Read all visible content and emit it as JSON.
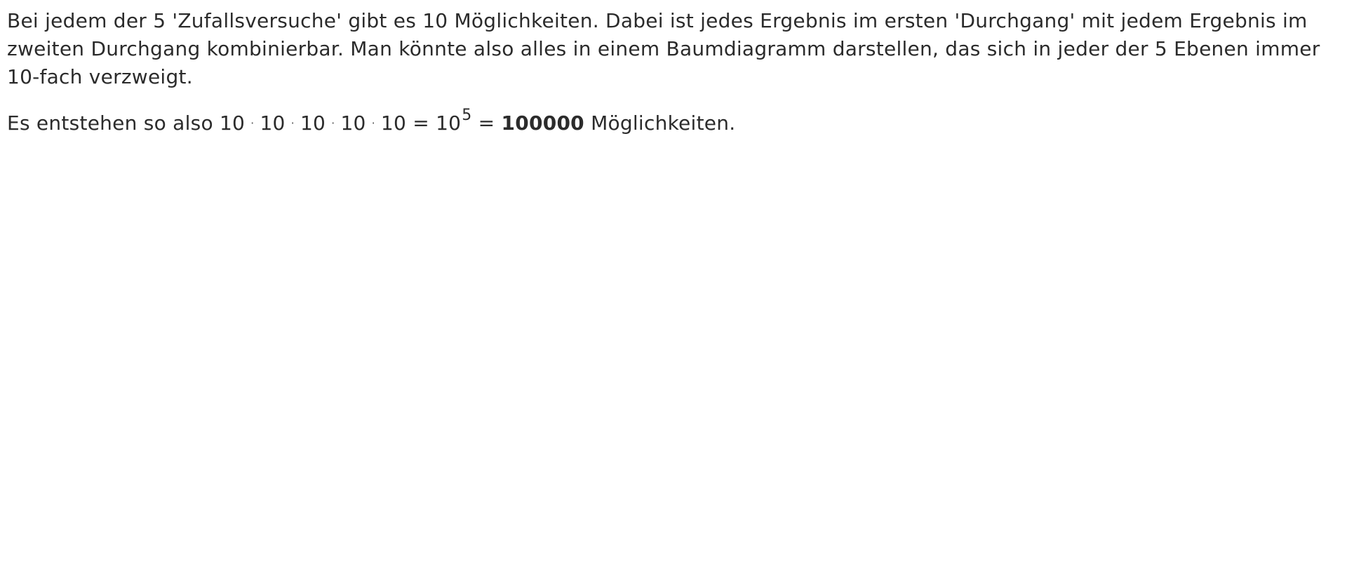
{
  "paragraph1": "Bei jedem der 5 'Zufallsversuche' gibt es 10 Möglichkeiten. Dabei ist jedes Ergebnis im ersten 'Durchgang' mit jedem Ergebnis im zweiten Durchgang kombinierbar. Man könnte also alles in einem Baumdiagramm darstellen, das sich in jeder der 5 Ebenen immer 10-fach verzweigt.",
  "paragraph2": {
    "prefix": "Es entstehen so also",
    "factors": [
      "10",
      "10",
      "10",
      "10",
      "10"
    ],
    "dot_symbol": "·",
    "equals": "=",
    "power_base": "10",
    "power_exponent": "5",
    "result": "100000",
    "suffix": "Möglichkeiten."
  }
}
